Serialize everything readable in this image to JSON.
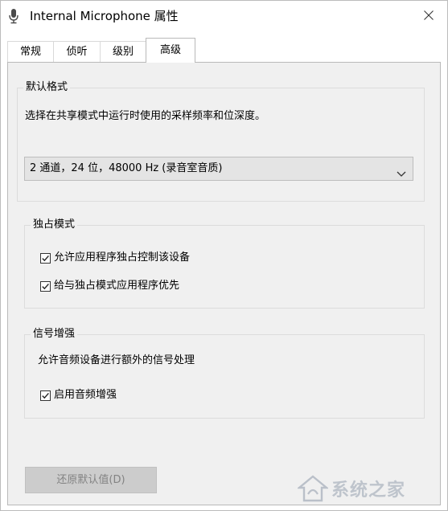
{
  "window": {
    "title": "Internal Microphone 属性",
    "close_glyph": "✕"
  },
  "tabs": [
    {
      "label": "常规",
      "active": false
    },
    {
      "label": "侦听",
      "active": false
    },
    {
      "label": "级别",
      "active": false
    },
    {
      "label": "高级",
      "active": true
    }
  ],
  "default_format": {
    "group_label": "默认格式",
    "description": "选择在共享模式中运行时使用的采样频率和位深度。",
    "selected_value": "2 通道，24 位，48000 Hz (录音室音质)"
  },
  "exclusive_mode": {
    "group_label": "独占模式",
    "options": [
      {
        "label": "允许应用程序独占控制该设备",
        "checked": true
      },
      {
        "label": "给与独占模式应用程序优先",
        "checked": true
      }
    ]
  },
  "signal_enhancement": {
    "group_label": "信号增强",
    "description": "允许音频设备进行额外的信号处理",
    "options": [
      {
        "label": "启用音频增强",
        "checked": true
      }
    ]
  },
  "footer": {
    "restore_defaults_label": "还原默认值(D)"
  },
  "watermark": {
    "text": "系统之家"
  },
  "icons": {
    "title": "microphone-icon",
    "close": "close-icon",
    "dropdown": "chevron-down-icon",
    "check": "checkmark-icon",
    "watermark": "house-logo-icon"
  },
  "colors": {
    "panel_bg": "#f0f0f0",
    "disabled_button_bg": "#cccccc",
    "disabled_text": "#838383",
    "dropdown_bg": "#e4e4e4"
  }
}
